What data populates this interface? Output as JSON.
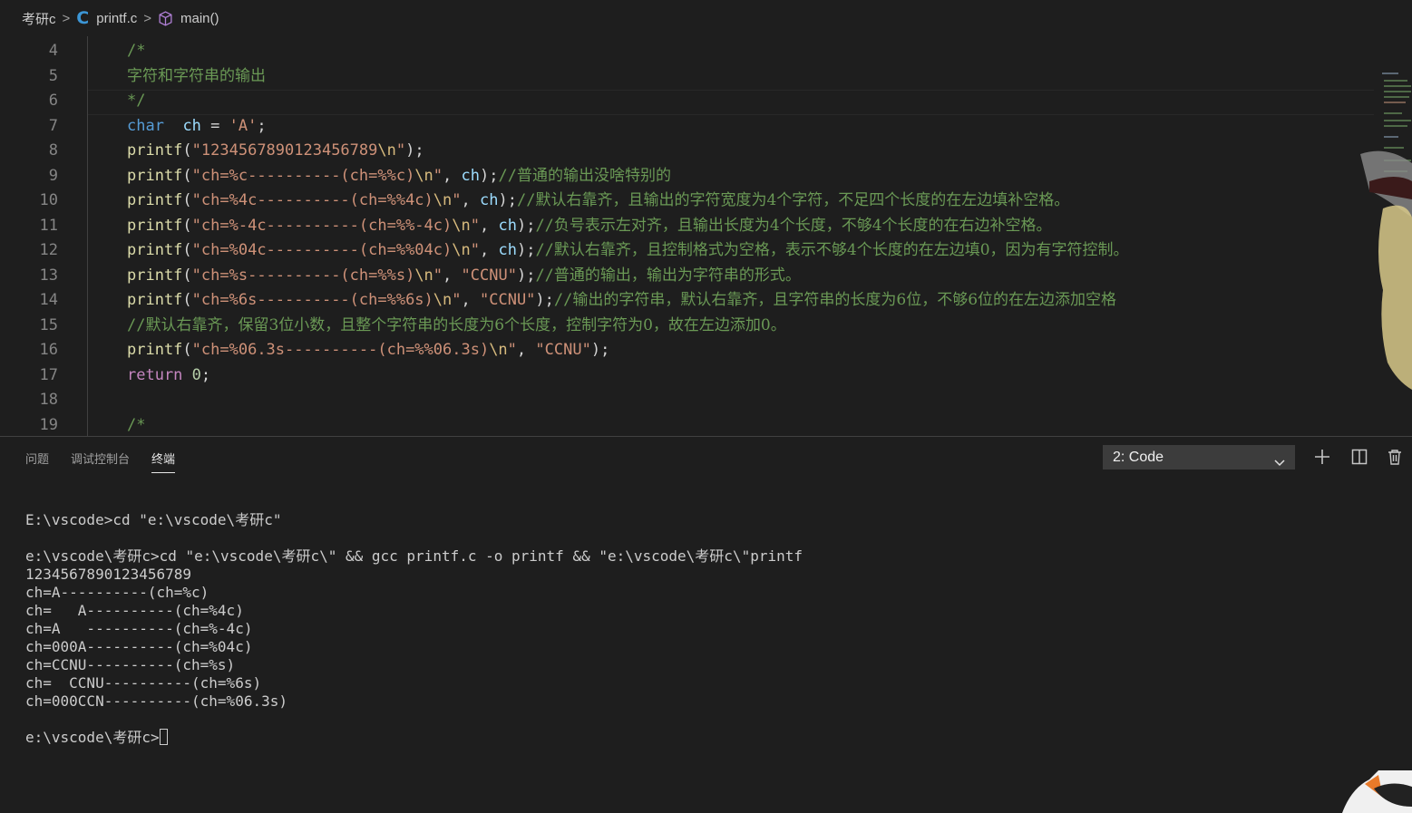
{
  "breadcrumb": {
    "folder": "考研c",
    "file": "printf.c",
    "symbol": "main()"
  },
  "editor": {
    "lines": [
      {
        "n": "4",
        "tokens": [
          [
            "cm",
            "/*"
          ]
        ]
      },
      {
        "n": "5",
        "tokens": [
          [
            "cm cmzh",
            "字符和字符串的输出"
          ]
        ]
      },
      {
        "n": "6",
        "tokens": [
          [
            "cm",
            "*/"
          ]
        ]
      },
      {
        "n": "7",
        "tokens": [
          [
            "k",
            "char"
          ],
          [
            "",
            "  "
          ],
          [
            "v",
            "ch"
          ],
          [
            "",
            " = "
          ],
          [
            "s",
            "'A'"
          ],
          [
            "",
            ";"
          ]
        ]
      },
      {
        "n": "8",
        "tokens": [
          [
            "fn",
            "printf"
          ],
          [
            "",
            "("
          ],
          [
            "s",
            "\"1234567890123456789"
          ],
          [
            "esc",
            "\\n"
          ],
          [
            "s",
            "\""
          ],
          [
            "",
            ");"
          ]
        ]
      },
      {
        "n": "9",
        "tokens": [
          [
            "fn",
            "printf"
          ],
          [
            "",
            "("
          ],
          [
            "s",
            "\"ch=%c----------(ch=%%c)"
          ],
          [
            "esc",
            "\\n"
          ],
          [
            "s",
            "\""
          ],
          [
            "",
            ", "
          ],
          [
            "v",
            "ch"
          ],
          [
            "",
            ");"
          ],
          [
            "cm",
            "//"
          ],
          [
            "cm cmzh",
            "普通的输出没啥特别的"
          ]
        ]
      },
      {
        "n": "10",
        "tokens": [
          [
            "fn",
            "printf"
          ],
          [
            "",
            "("
          ],
          [
            "s",
            "\"ch=%4c----------(ch=%%4c)"
          ],
          [
            "esc",
            "\\n"
          ],
          [
            "s",
            "\""
          ],
          [
            "",
            ", "
          ],
          [
            "v",
            "ch"
          ],
          [
            "",
            ");"
          ],
          [
            "cm",
            "//"
          ],
          [
            "cm cmzh",
            "默认右靠齐，且输出的字符宽度为4个字符，不足四个长度的在左边填补空格。"
          ]
        ]
      },
      {
        "n": "11",
        "tokens": [
          [
            "fn",
            "printf"
          ],
          [
            "",
            "("
          ],
          [
            "s",
            "\"ch=%-4c----------(ch=%%-4c)"
          ],
          [
            "esc",
            "\\n"
          ],
          [
            "s",
            "\""
          ],
          [
            "",
            ", "
          ],
          [
            "v",
            "ch"
          ],
          [
            "",
            ");"
          ],
          [
            "cm",
            "//"
          ],
          [
            "cm cmzh",
            "负号表示左对齐，且输出长度为4个长度，不够4个长度的在右边补空格。"
          ]
        ]
      },
      {
        "n": "12",
        "tokens": [
          [
            "fn",
            "printf"
          ],
          [
            "",
            "("
          ],
          [
            "s",
            "\"ch=%04c----------(ch=%%04c)"
          ],
          [
            "esc",
            "\\n"
          ],
          [
            "s",
            "\""
          ],
          [
            "",
            ", "
          ],
          [
            "v",
            "ch"
          ],
          [
            "",
            ");"
          ],
          [
            "cm",
            "//"
          ],
          [
            "cm cmzh",
            "默认右靠齐，且控制格式为空格，表示不够4个长度的在左边填0，因为有字符控制。"
          ]
        ]
      },
      {
        "n": "13",
        "tokens": [
          [
            "fn",
            "printf"
          ],
          [
            "",
            "("
          ],
          [
            "s",
            "\"ch=%s----------(ch=%%s)"
          ],
          [
            "esc",
            "\\n"
          ],
          [
            "s",
            "\""
          ],
          [
            "",
            ", "
          ],
          [
            "s",
            "\"CCNU\""
          ],
          [
            "",
            ");"
          ],
          [
            "cm",
            "//"
          ],
          [
            "cm cmzh",
            "普通的输出，输出为字符串的形式。"
          ]
        ]
      },
      {
        "n": "14",
        "tokens": [
          [
            "fn",
            "printf"
          ],
          [
            "",
            "("
          ],
          [
            "s",
            "\"ch=%6s----------(ch=%%6s)"
          ],
          [
            "esc",
            "\\n"
          ],
          [
            "s",
            "\""
          ],
          [
            "",
            ", "
          ],
          [
            "s",
            "\"CCNU\""
          ],
          [
            "",
            ");"
          ],
          [
            "cm",
            "//"
          ],
          [
            "cm cmzh",
            "输出的字符串，默认右靠齐，且字符串的长度为6位，不够6位的在左边添加空格"
          ]
        ]
      },
      {
        "n": "15",
        "tokens": [
          [
            "cm",
            "//"
          ],
          [
            "cm cmzh",
            "默认右靠齐，保留3位小数，且整个字符串的长度为6个长度，控制字符为0，故在左边添加0。"
          ]
        ]
      },
      {
        "n": "16",
        "tokens": [
          [
            "fn",
            "printf"
          ],
          [
            "",
            "("
          ],
          [
            "s",
            "\"ch=%06.3s----------(ch=%%06.3s)"
          ],
          [
            "esc",
            "\\n"
          ],
          [
            "s",
            "\""
          ],
          [
            "",
            ", "
          ],
          [
            "s",
            "\"CCNU\""
          ],
          [
            "",
            ");"
          ]
        ]
      },
      {
        "n": "17",
        "tokens": [
          [
            "kw",
            "return"
          ],
          [
            "",
            " "
          ],
          [
            "n",
            "0"
          ],
          [
            "",
            ";"
          ]
        ]
      },
      {
        "n": "18",
        "tokens": []
      },
      {
        "n": "19",
        "tokens": [
          [
            "cm",
            "/*"
          ]
        ]
      }
    ]
  },
  "panel": {
    "tabs": [
      "问题",
      "调试控制台",
      "终端"
    ],
    "active_tab": "终端",
    "terminal_select": "2: Code",
    "terminal_lines": [
      "E:\\vscode>cd \"e:\\vscode\\考研c\"",
      "",
      "e:\\vscode\\考研c>cd \"e:\\vscode\\考研c\\\" && gcc printf.c -o printf && \"e:\\vscode\\考研c\\\"printf",
      "1234567890123456789",
      "ch=A----------(ch=%c)",
      "ch=   A----------(ch=%4c)",
      "ch=A   ----------(ch=%-4c)",
      "ch=000A----------(ch=%04c)",
      "ch=CCNU----------(ch=%s)",
      "ch=  CCNU----------(ch=%6s)",
      "ch=000CCN----------(ch=%06.3s)",
      "",
      "e:\\vscode\\考研c>"
    ]
  },
  "icons": {
    "c_file": "c-language-icon",
    "symbol": "cube-icon",
    "chevron": "chevron-down-icon",
    "add": "plus-icon",
    "split": "split-icon",
    "trash": "trash-icon"
  },
  "colors": {
    "background": "#1e1e1e",
    "keyword": "#569cd6",
    "string": "#ce9178",
    "comment": "#6a9955",
    "function": "#dcdcaa",
    "variable": "#9cdcfe"
  }
}
